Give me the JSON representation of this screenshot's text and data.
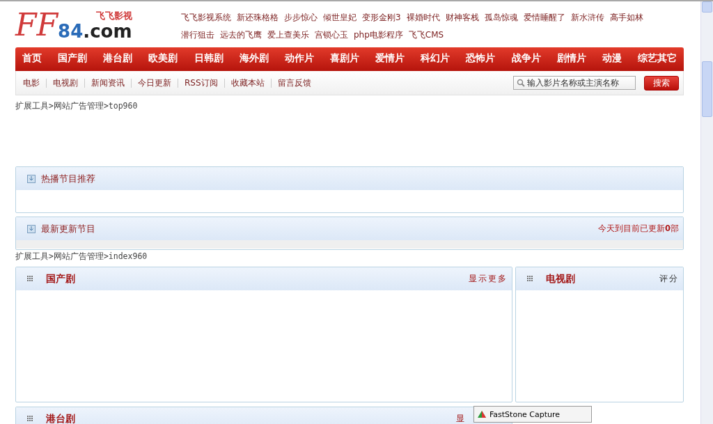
{
  "logo": {
    "main": "FF",
    "number": "84",
    "domain": ".com",
    "tagline": "飞飞影视"
  },
  "hot_links": [
    "飞飞影视系统",
    "新还珠格格",
    "步步惊心",
    "倾世皇妃",
    "变形金刚3",
    "裸婚时代",
    "财神客栈",
    "孤岛惊魂",
    "爱情睡醒了",
    "新水浒传",
    "高手如林",
    "潜行狙击",
    "远去的飞鹰",
    "爱上查美乐",
    "宫锁心玉",
    "php电影程序",
    "飞飞CMS"
  ],
  "main_nav": [
    {
      "label": "首页",
      "selected": false
    },
    {
      "label": "国产剧",
      "selected": false
    },
    {
      "label": "港台剧",
      "selected": false
    },
    {
      "label": "欧美剧",
      "selected": false
    },
    {
      "label": "日韩剧",
      "selected": false
    },
    {
      "label": "海外剧",
      "selected": false
    },
    {
      "label": "动作片",
      "selected": false
    },
    {
      "label": "喜剧片",
      "selected": false
    },
    {
      "label": "爱情片",
      "selected": false
    },
    {
      "label": "科幻片",
      "selected": false
    },
    {
      "label": "恐怖片",
      "selected": false
    },
    {
      "label": "战争片",
      "selected": false
    },
    {
      "label": "剧情片",
      "selected": false
    },
    {
      "label": "动漫",
      "selected": false
    },
    {
      "label": "综艺其它",
      "selected": false
    }
  ],
  "sub_nav": [
    "电影",
    "电视剧",
    "新闻资讯",
    "今日更新",
    "RSS订阅",
    "收藏本站",
    "留言反馈"
  ],
  "search": {
    "placeholder": "输入影片名称或主演名称",
    "button": "搜索"
  },
  "ad_top": "扩展工具>网站广告管理>top960",
  "hot_panel": {
    "title": "热播节目推荐"
  },
  "latest_panel": {
    "title": "最新更新节目",
    "note": "今天到目前已更新**0**部"
  },
  "ad_index": "扩展工具>网站广告管理>index960",
  "category_panels": [
    {
      "title": "国产剧",
      "more": "显示更多"
    },
    {
      "title": "港台剧",
      "more": "显"
    }
  ],
  "side_panel": {
    "title": "电视剧",
    "extra": "评分"
  },
  "capture_popup": {
    "title": "FastStone Capture"
  }
}
